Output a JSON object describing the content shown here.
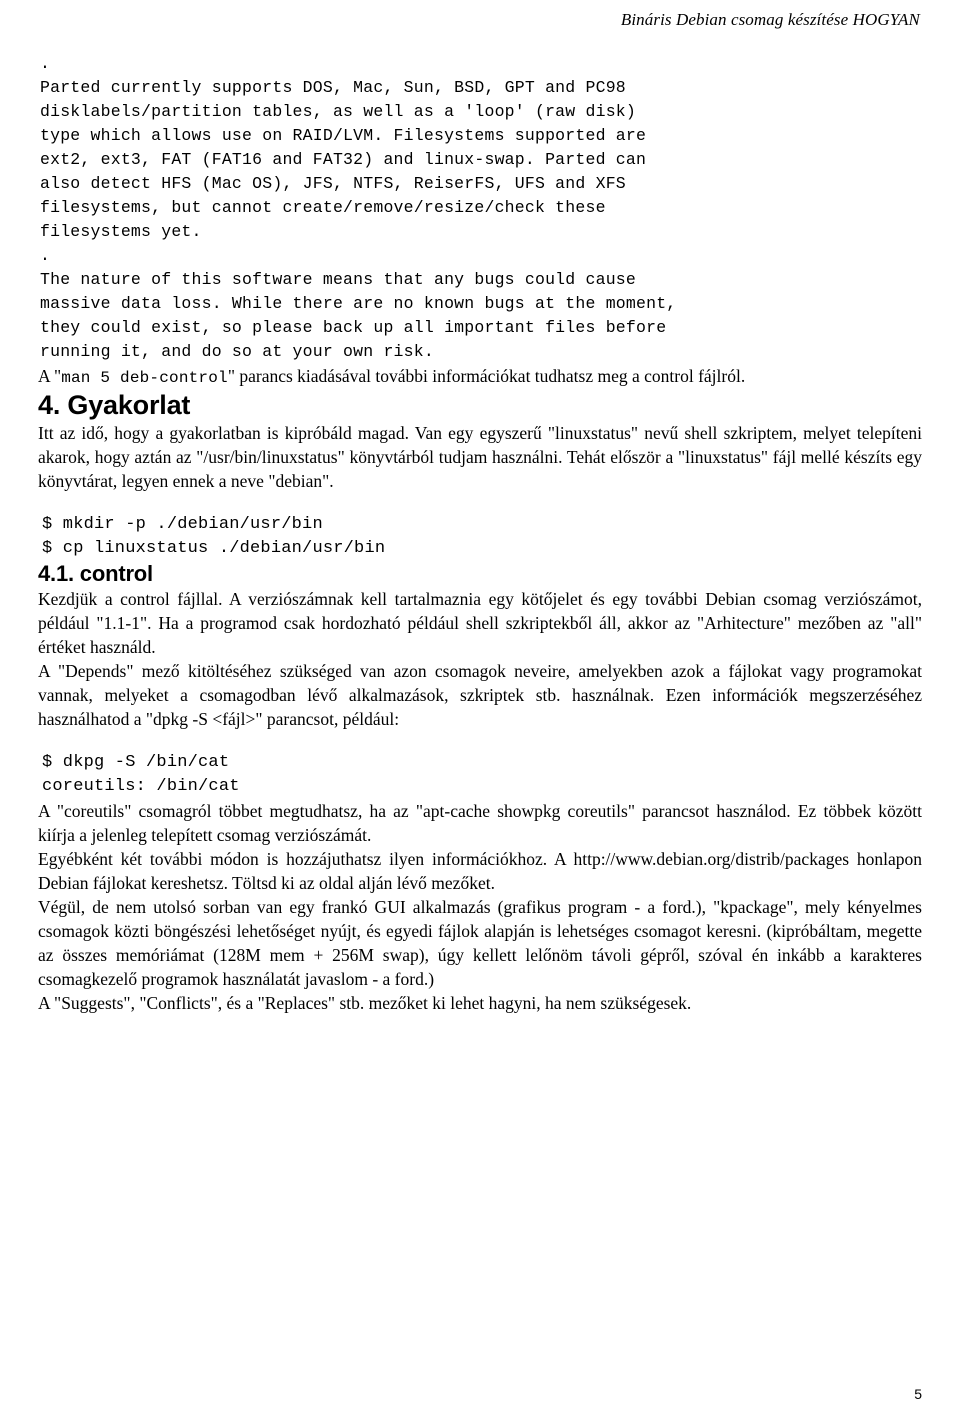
{
  "header": {
    "running_title": "Bináris Debian csomag készítése HOGYAN"
  },
  "code_intro": {
    "lines": [
      ".",
      "Parted currently supports DOS, Mac, Sun, BSD, GPT and PC98",
      "disklabels/partition tables, as well as a 'loop' (raw disk)",
      "type which allows use on RAID/LVM. Filesystems supported are",
      "ext2, ext3, FAT (FAT16 and FAT32) and linux-swap. Parted can",
      "also detect HFS (Mac OS), JFS, NTFS, ReiserFS, UFS and XFS",
      "filesystems, but cannot create/remove/resize/check these",
      "filesystems yet.",
      ".",
      "The nature of this software means that any bugs could cause",
      "massive data loss. While there are no known bugs at the moment,",
      "they could exist, so please back up all important files before",
      "running it, and do so at your own risk."
    ]
  },
  "para_control": {
    "prefix": "A \"",
    "mono": "man 5 deb-control",
    "suffix": "\" parancs kiadásával további információkat tudhatsz meg a control fájlról."
  },
  "section4": {
    "heading": "4. Gyakorlat",
    "paragraph": "Itt az idő, hogy a gyakorlatban is kipróbáld magad. Van egy egyszerű \"linuxstatus\" nevű shell szkriptem, melyet telepíteni akarok, hogy aztán az \"/usr/bin/linuxstatus\" könyvtárból tudjam használni. Tehát először a \"linuxstatus\" fájl mellé készíts egy könyvtárat, legyen ennek a neve \"debian\".",
    "commands": [
      "$ mkdir -p ./debian/usr/bin",
      "$ cp linuxstatus ./debian/usr/bin"
    ]
  },
  "section41": {
    "heading": "4.1. control",
    "paragraph1": "Kezdjük a control fájllal. A verziószámnak kell tartalmaznia egy kötőjelet és egy további Debian csomag verziószámot, például \"1.1-1\". Ha a programod csak hordozható például shell szkriptekből áll, akkor az \"Arhitecture\" mezőben az \"all\" értéket használd.",
    "paragraph2": "A \"Depends\" mező kitöltéséhez szükséged van azon csomagok neveire, amelyekben azok a fájlokat vagy programokat vannak, melyeket a csomagodban lévő alkalmazások, szkriptek stb. használnak. Ezen információk megszerzéséhez használhatod a \"dpkg -S <fájl>\" parancsot, például:",
    "commands": [
      "$ dkpg -S /bin/cat",
      "coreutils: /bin/cat"
    ],
    "paragraph3": "A \"coreutils\" csomagról többet megtudhatsz, ha az \"apt-cache showpkg coreutils\" parancsot használod. Ez többek között kiírja a jelenleg telepített csomag verziószámát.",
    "paragraph4": "Egyébként két további módon is hozzájuthatsz ilyen információkhoz. A http://www.debian.org/distrib/packages honlapon Debian fájlokat kereshetsz. Töltsd ki az oldal alján lévő mezőket.",
    "paragraph5": "Végül, de nem utolsó sorban van egy frankó GUI alkalmazás (grafikus program - a ford.), \"kpackage\", mely kényelmes csomagok közti böngészési lehetőséget nyújt, és egyedi fájlok alapján is lehetséges csomagot keresni. (kipróbáltam, megette az összes memóriámat (128M mem + 256M swap), úgy kellett lelőnöm távoli gépről, szóval én inkább a karakteres csomagkezelő programok használatát javaslom - a ford.)",
    "paragraph6": "A \"Suggests\", \"Conflicts\", és a \"Replaces\" stb. mezőket ki lehet hagyni, ha nem szükségesek."
  },
  "footer": {
    "page_number": "5"
  }
}
